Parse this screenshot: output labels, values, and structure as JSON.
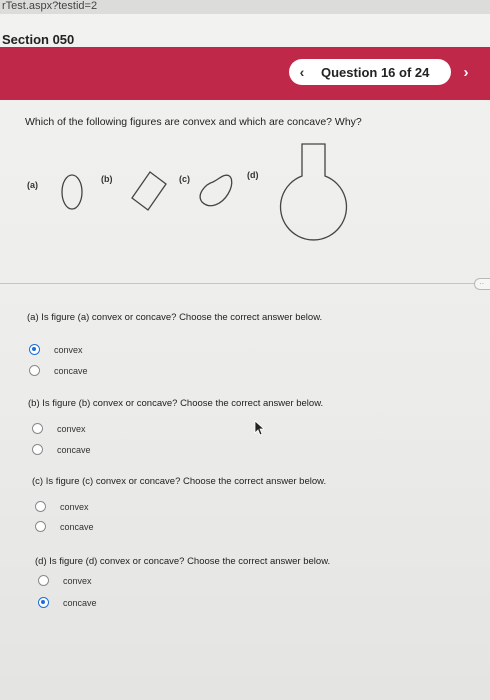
{
  "url_fragment": "rTest.aspx?testid=2",
  "section_title": "Section 050",
  "question_nav": {
    "label": "Question 16 of 24",
    "prev_icon": "chevron-left-icon",
    "next_icon": "chevron-right-icon"
  },
  "prompt": "Which of the following figures are convex and which are concave? Why?",
  "figure_labels": [
    "(a)",
    "(b)",
    "(c)",
    "(d)"
  ],
  "questions": [
    {
      "text": "(a) Is figure (a) convex or concave? Choose the correct answer below.",
      "options": [
        "convex",
        "concave"
      ],
      "selected": 0
    },
    {
      "text": "(b) Is figure (b) convex or concave? Choose the correct answer below.",
      "options": [
        "convex",
        "concave"
      ],
      "selected": null
    },
    {
      "text": "(c) Is figure (c) convex or concave? Choose the correct answer below.",
      "options": [
        "convex",
        "concave"
      ],
      "selected": null
    },
    {
      "text": "(d) Is figure (d) convex or concave? Choose the correct answer below.",
      "options": [
        "convex",
        "concave"
      ],
      "selected": 1
    }
  ],
  "colors": {
    "banner": "#c0284a",
    "radio_selected": "#1f6fd6"
  }
}
